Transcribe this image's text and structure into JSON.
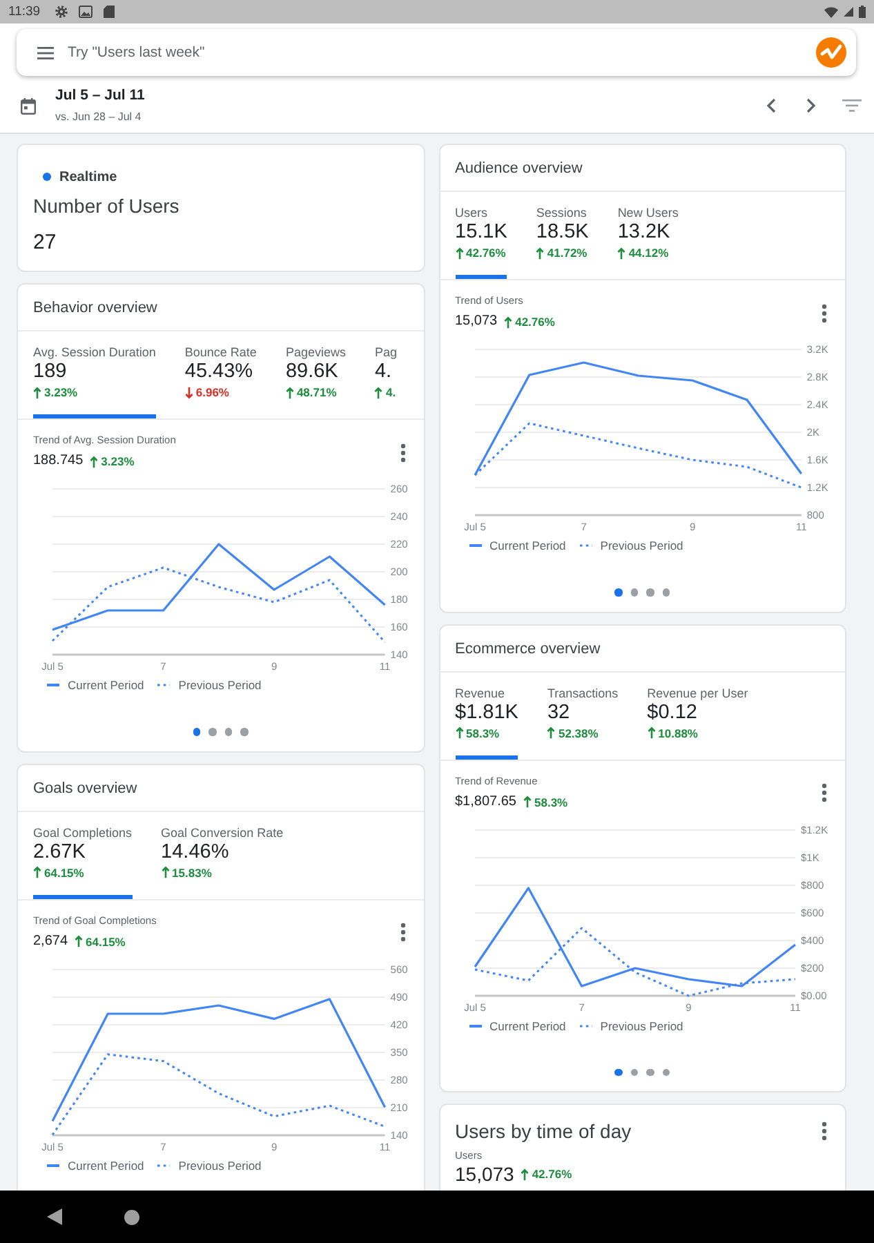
{
  "status_bar": {
    "time": "11:39"
  },
  "search": {
    "placeholder": "Try \"Users last week\""
  },
  "date_range": {
    "range": "Jul 5 – Jul 11",
    "comparison": "vs. Jun 28 – Jul 4"
  },
  "left_column": [
    {
      "kind": "realtime",
      "label": "Realtime",
      "metric": "Number of Users",
      "value": "27"
    },
    {
      "kind": "overview",
      "title": "Behavior overview",
      "metrics": [
        {
          "label": "Avg. Session Duration",
          "value": "189",
          "change": "3.23%",
          "rising": true,
          "selected": true
        },
        {
          "label": "Bounce Rate",
          "value": "45.43%",
          "change": "6.96%",
          "rising": false,
          "selected": false
        },
        {
          "label": "Pageviews",
          "value": "89.6K",
          "change": "48.71%",
          "rising": true,
          "selected": false
        },
        {
          "label": "Pag",
          "value": "4.",
          "change": "4.",
          "rising": true,
          "selected": false
        }
      ],
      "trend": {
        "title": "Trend of Avg. Session Duration",
        "value": "188.745",
        "change": "3.23%",
        "rising": true,
        "chart_data": {
          "type": "line",
          "grid": true,
          "legend": "bottom",
          "x": [
            5,
            6,
            7,
            8,
            9,
            10,
            11
          ],
          "xlim": [
            5,
            11
          ],
          "ylim": [
            140,
            260
          ],
          "xticks": [
            {
              "value": 5,
              "label": "Jul 5"
            },
            {
              "value": 7,
              "label": "7"
            },
            {
              "value": 9,
              "label": "9"
            },
            {
              "value": 11,
              "label": "11"
            }
          ],
          "yticks": [
            140,
            160,
            180,
            200,
            220,
            240,
            260
          ],
          "series": [
            {
              "name": "Current Period",
              "color": "#4285f4",
              "line_style": "solid",
              "values": [
                158,
                172,
                172,
                220,
                187,
                211,
                176
              ]
            },
            {
              "name": "Previous Period",
              "color": "#4285f4",
              "line_style": "dotted",
              "values": [
                150,
                189,
                203,
                189,
                178,
                194,
                149
              ]
            }
          ]
        }
      },
      "pages": [
        {
          "selected": true
        },
        {
          "selected": false
        },
        {
          "selected": false
        },
        {
          "selected": false
        }
      ]
    },
    {
      "kind": "overview",
      "title": "Goals overview",
      "metrics": [
        {
          "label": "Goal Completions",
          "value": "2.67K",
          "change": "64.15%",
          "rising": true,
          "selected": true
        },
        {
          "label": "Goal Conversion Rate",
          "value": "14.46%",
          "change": "15.83%",
          "rising": true,
          "selected": false
        }
      ],
      "trend": {
        "title": "Trend of Goal Completions",
        "value": "2,674",
        "change": "64.15%",
        "rising": true,
        "chart_data": {
          "type": "line",
          "grid": true,
          "legend": "bottom",
          "x": [
            5,
            6,
            7,
            8,
            9,
            10,
            11
          ],
          "xlim": [
            5,
            11
          ],
          "ylim": [
            140,
            560
          ],
          "xticks": [
            {
              "value": 5,
              "label": "Jul 5"
            },
            {
              "value": 7,
              "label": "7"
            },
            {
              "value": 9,
              "label": "9"
            },
            {
              "value": 11,
              "label": "11"
            }
          ],
          "yticks": [
            140,
            210,
            280,
            350,
            420,
            490,
            560
          ],
          "series": [
            {
              "name": "Current Period",
              "color": "#4285f4",
              "line_style": "solid",
              "values": [
                176,
                448,
                448,
                469,
                435,
                485,
                211
              ]
            },
            {
              "name": "Previous Period",
              "color": "#4285f4",
              "line_style": "dotted",
              "values": [
                141,
                345,
                328,
                246,
                188,
                215,
                162
              ]
            }
          ]
        }
      }
    }
  ],
  "right_column": [
    {
      "kind": "overview",
      "title": "Audience overview",
      "metrics": [
        {
          "label": "Users",
          "value": "15.1K",
          "change": "42.76%",
          "rising": true,
          "selected": true
        },
        {
          "label": "Sessions",
          "value": "18.5K",
          "change": "41.72%",
          "rising": true,
          "selected": false
        },
        {
          "label": "New Users",
          "value": "13.2K",
          "change": "44.12%",
          "rising": true,
          "selected": false
        }
      ],
      "trend": {
        "title": "Trend of Users",
        "value": "15,073",
        "change": "42.76%",
        "rising": true,
        "chart_data": {
          "type": "line",
          "grid": true,
          "legend": "bottom",
          "x": [
            5,
            6,
            7,
            8,
            9,
            10,
            11
          ],
          "xlim": [
            5,
            11
          ],
          "ylim": [
            800,
            3200
          ],
          "xticks": [
            {
              "value": 5,
              "label": "Jul 5"
            },
            {
              "value": 7,
              "label": "7"
            },
            {
              "value": 9,
              "label": "9"
            },
            {
              "value": 11,
              "label": "11"
            }
          ],
          "yticks": [
            800,
            {
              "value": 1200,
              "label": "1.2K"
            },
            {
              "value": 1600,
              "label": "1.6K"
            },
            {
              "value": 2000,
              "label": "2K"
            },
            {
              "value": 2400,
              "label": "2.4K"
            },
            {
              "value": 2800,
              "label": "2.8K"
            },
            {
              "value": 3200,
              "label": "3.2K"
            }
          ],
          "series": [
            {
              "name": "Current Period",
              "color": "#4285f4",
              "line_style": "solid",
              "values": [
                1380,
                2830,
                3010,
                2820,
                2750,
                2470,
                1400
              ]
            },
            {
              "name": "Previous Period",
              "color": "#4285f4",
              "line_style": "dotted",
              "values": [
                1380,
                2130,
                1950,
                1770,
                1600,
                1500,
                1200
              ]
            }
          ]
        }
      },
      "pages": [
        {
          "selected": true
        },
        {
          "selected": false
        },
        {
          "selected": false
        },
        {
          "selected": false
        }
      ]
    },
    {
      "kind": "overview",
      "title": "Ecommerce overview",
      "metrics": [
        {
          "label": "Revenue",
          "value": "$1.81K",
          "change": "58.3%",
          "rising": true,
          "selected": true
        },
        {
          "label": "Transactions",
          "value": "32",
          "change": "52.38%",
          "rising": true,
          "selected": false
        },
        {
          "label": "Revenue per User",
          "value": "$0.12",
          "change": "10.88%",
          "rising": true,
          "selected": false
        }
      ],
      "trend": {
        "title": "Trend of Revenue",
        "value": "$1,807.65",
        "change": "58.3%",
        "rising": true,
        "chart_data": {
          "type": "line",
          "grid": true,
          "legend": "bottom",
          "x": [
            5,
            6,
            7,
            8,
            9,
            10,
            11
          ],
          "xlim": [
            5,
            11
          ],
          "ylim": [
            0,
            1200
          ],
          "xticks": [
            {
              "value": 5,
              "label": "Jul 5"
            },
            {
              "value": 7,
              "label": "7"
            },
            {
              "value": 9,
              "label": "9"
            },
            {
              "value": 11,
              "label": "11"
            }
          ],
          "yticks": [
            {
              "value": 0,
              "label": "$0.00"
            },
            {
              "value": 200,
              "label": "$200"
            },
            {
              "value": 400,
              "label": "$400"
            },
            {
              "value": 600,
              "label": "$600"
            },
            {
              "value": 800,
              "label": "$800"
            },
            {
              "value": 1000,
              "label": "$1K"
            },
            {
              "value": 1200,
              "label": "$1.2K"
            }
          ],
          "series": [
            {
              "name": "Current Period",
              "color": "#4285f4",
              "line_style": "solid",
              "values": [
                210,
                780,
                70,
                200,
                120,
                70,
                370
              ]
            },
            {
              "name": "Previous Period",
              "color": "#4285f4",
              "line_style": "dotted",
              "values": [
                190,
                110,
                490,
                170,
                0,
                90,
                120
              ]
            }
          ]
        }
      },
      "pages": [
        {
          "selected": true
        },
        {
          "selected": false
        },
        {
          "selected": false
        },
        {
          "selected": false
        }
      ]
    },
    {
      "kind": "time_of_day",
      "title": "Users by time of day",
      "metric": "Users",
      "value": "15,073",
      "change": "42.76%",
      "rising": true
    }
  ]
}
